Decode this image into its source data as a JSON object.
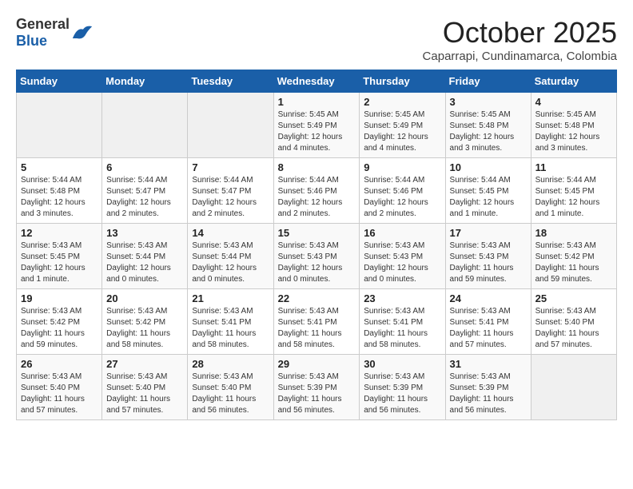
{
  "header": {
    "logo_general": "General",
    "logo_blue": "Blue",
    "month_title": "October 2025",
    "subtitle": "Caparrapi, Cundinamarca, Colombia"
  },
  "weekdays": [
    "Sunday",
    "Monday",
    "Tuesday",
    "Wednesday",
    "Thursday",
    "Friday",
    "Saturday"
  ],
  "weeks": [
    [
      {
        "day": "",
        "info": ""
      },
      {
        "day": "",
        "info": ""
      },
      {
        "day": "",
        "info": ""
      },
      {
        "day": "1",
        "info": "Sunrise: 5:45 AM\nSunset: 5:49 PM\nDaylight: 12 hours\nand 4 minutes."
      },
      {
        "day": "2",
        "info": "Sunrise: 5:45 AM\nSunset: 5:49 PM\nDaylight: 12 hours\nand 4 minutes."
      },
      {
        "day": "3",
        "info": "Sunrise: 5:45 AM\nSunset: 5:48 PM\nDaylight: 12 hours\nand 3 minutes."
      },
      {
        "day": "4",
        "info": "Sunrise: 5:45 AM\nSunset: 5:48 PM\nDaylight: 12 hours\nand 3 minutes."
      }
    ],
    [
      {
        "day": "5",
        "info": "Sunrise: 5:44 AM\nSunset: 5:48 PM\nDaylight: 12 hours\nand 3 minutes."
      },
      {
        "day": "6",
        "info": "Sunrise: 5:44 AM\nSunset: 5:47 PM\nDaylight: 12 hours\nand 2 minutes."
      },
      {
        "day": "7",
        "info": "Sunrise: 5:44 AM\nSunset: 5:47 PM\nDaylight: 12 hours\nand 2 minutes."
      },
      {
        "day": "8",
        "info": "Sunrise: 5:44 AM\nSunset: 5:46 PM\nDaylight: 12 hours\nand 2 minutes."
      },
      {
        "day": "9",
        "info": "Sunrise: 5:44 AM\nSunset: 5:46 PM\nDaylight: 12 hours\nand 2 minutes."
      },
      {
        "day": "10",
        "info": "Sunrise: 5:44 AM\nSunset: 5:45 PM\nDaylight: 12 hours\nand 1 minute."
      },
      {
        "day": "11",
        "info": "Sunrise: 5:44 AM\nSunset: 5:45 PM\nDaylight: 12 hours\nand 1 minute."
      }
    ],
    [
      {
        "day": "12",
        "info": "Sunrise: 5:43 AM\nSunset: 5:45 PM\nDaylight: 12 hours\nand 1 minute."
      },
      {
        "day": "13",
        "info": "Sunrise: 5:43 AM\nSunset: 5:44 PM\nDaylight: 12 hours\nand 0 minutes."
      },
      {
        "day": "14",
        "info": "Sunrise: 5:43 AM\nSunset: 5:44 PM\nDaylight: 12 hours\nand 0 minutes."
      },
      {
        "day": "15",
        "info": "Sunrise: 5:43 AM\nSunset: 5:43 PM\nDaylight: 12 hours\nand 0 minutes."
      },
      {
        "day": "16",
        "info": "Sunrise: 5:43 AM\nSunset: 5:43 PM\nDaylight: 12 hours\nand 0 minutes."
      },
      {
        "day": "17",
        "info": "Sunrise: 5:43 AM\nSunset: 5:43 PM\nDaylight: 11 hours\nand 59 minutes."
      },
      {
        "day": "18",
        "info": "Sunrise: 5:43 AM\nSunset: 5:42 PM\nDaylight: 11 hours\nand 59 minutes."
      }
    ],
    [
      {
        "day": "19",
        "info": "Sunrise: 5:43 AM\nSunset: 5:42 PM\nDaylight: 11 hours\nand 59 minutes."
      },
      {
        "day": "20",
        "info": "Sunrise: 5:43 AM\nSunset: 5:42 PM\nDaylight: 11 hours\nand 58 minutes."
      },
      {
        "day": "21",
        "info": "Sunrise: 5:43 AM\nSunset: 5:41 PM\nDaylight: 11 hours\nand 58 minutes."
      },
      {
        "day": "22",
        "info": "Sunrise: 5:43 AM\nSunset: 5:41 PM\nDaylight: 11 hours\nand 58 minutes."
      },
      {
        "day": "23",
        "info": "Sunrise: 5:43 AM\nSunset: 5:41 PM\nDaylight: 11 hours\nand 58 minutes."
      },
      {
        "day": "24",
        "info": "Sunrise: 5:43 AM\nSunset: 5:41 PM\nDaylight: 11 hours\nand 57 minutes."
      },
      {
        "day": "25",
        "info": "Sunrise: 5:43 AM\nSunset: 5:40 PM\nDaylight: 11 hours\nand 57 minutes."
      }
    ],
    [
      {
        "day": "26",
        "info": "Sunrise: 5:43 AM\nSunset: 5:40 PM\nDaylight: 11 hours\nand 57 minutes."
      },
      {
        "day": "27",
        "info": "Sunrise: 5:43 AM\nSunset: 5:40 PM\nDaylight: 11 hours\nand 57 minutes."
      },
      {
        "day": "28",
        "info": "Sunrise: 5:43 AM\nSunset: 5:40 PM\nDaylight: 11 hours\nand 56 minutes."
      },
      {
        "day": "29",
        "info": "Sunrise: 5:43 AM\nSunset: 5:39 PM\nDaylight: 11 hours\nand 56 minutes."
      },
      {
        "day": "30",
        "info": "Sunrise: 5:43 AM\nSunset: 5:39 PM\nDaylight: 11 hours\nand 56 minutes."
      },
      {
        "day": "31",
        "info": "Sunrise: 5:43 AM\nSunset: 5:39 PM\nDaylight: 11 hours\nand 56 minutes."
      },
      {
        "day": "",
        "info": ""
      }
    ]
  ]
}
